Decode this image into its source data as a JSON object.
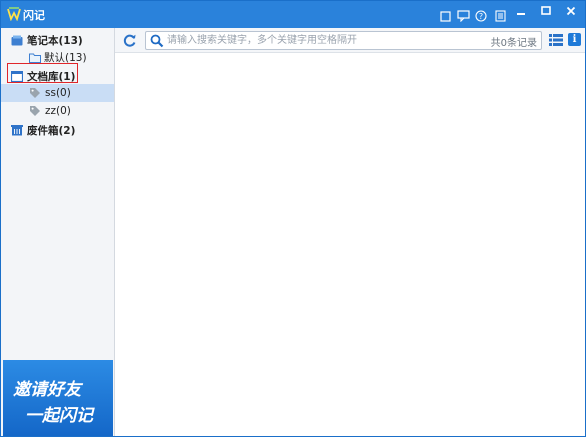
{
  "window": {
    "title": "闪记"
  },
  "titlebar_icons": [
    "skin-icon",
    "feedback-icon",
    "help-icon",
    "menu-icon"
  ],
  "window_controls": [
    "minimize-icon",
    "maximize-icon",
    "close-icon"
  ],
  "sidebar": {
    "notebook": {
      "label": "笔记本(13)",
      "children": [
        {
          "label": "默认(13)"
        }
      ]
    },
    "library": {
      "label": "文档库(1)",
      "children": [
        {
          "label": "ss(0)"
        },
        {
          "label": "zz(0)"
        }
      ]
    },
    "trash": {
      "label": "废件箱(2)"
    }
  },
  "search": {
    "placeholder": "请输入搜索关键字，多个关键字用空格隔开",
    "count_text": "共0条记录"
  },
  "toolbar": {
    "info_label": "i"
  },
  "banner": {
    "line1": "邀请好友",
    "line2": "一起闪记"
  },
  "colors": {
    "titlebar": "#2a82db",
    "selected_row": "#c9ddf5",
    "highlight_border": "#e0262b",
    "banner": "#1a72d3"
  }
}
